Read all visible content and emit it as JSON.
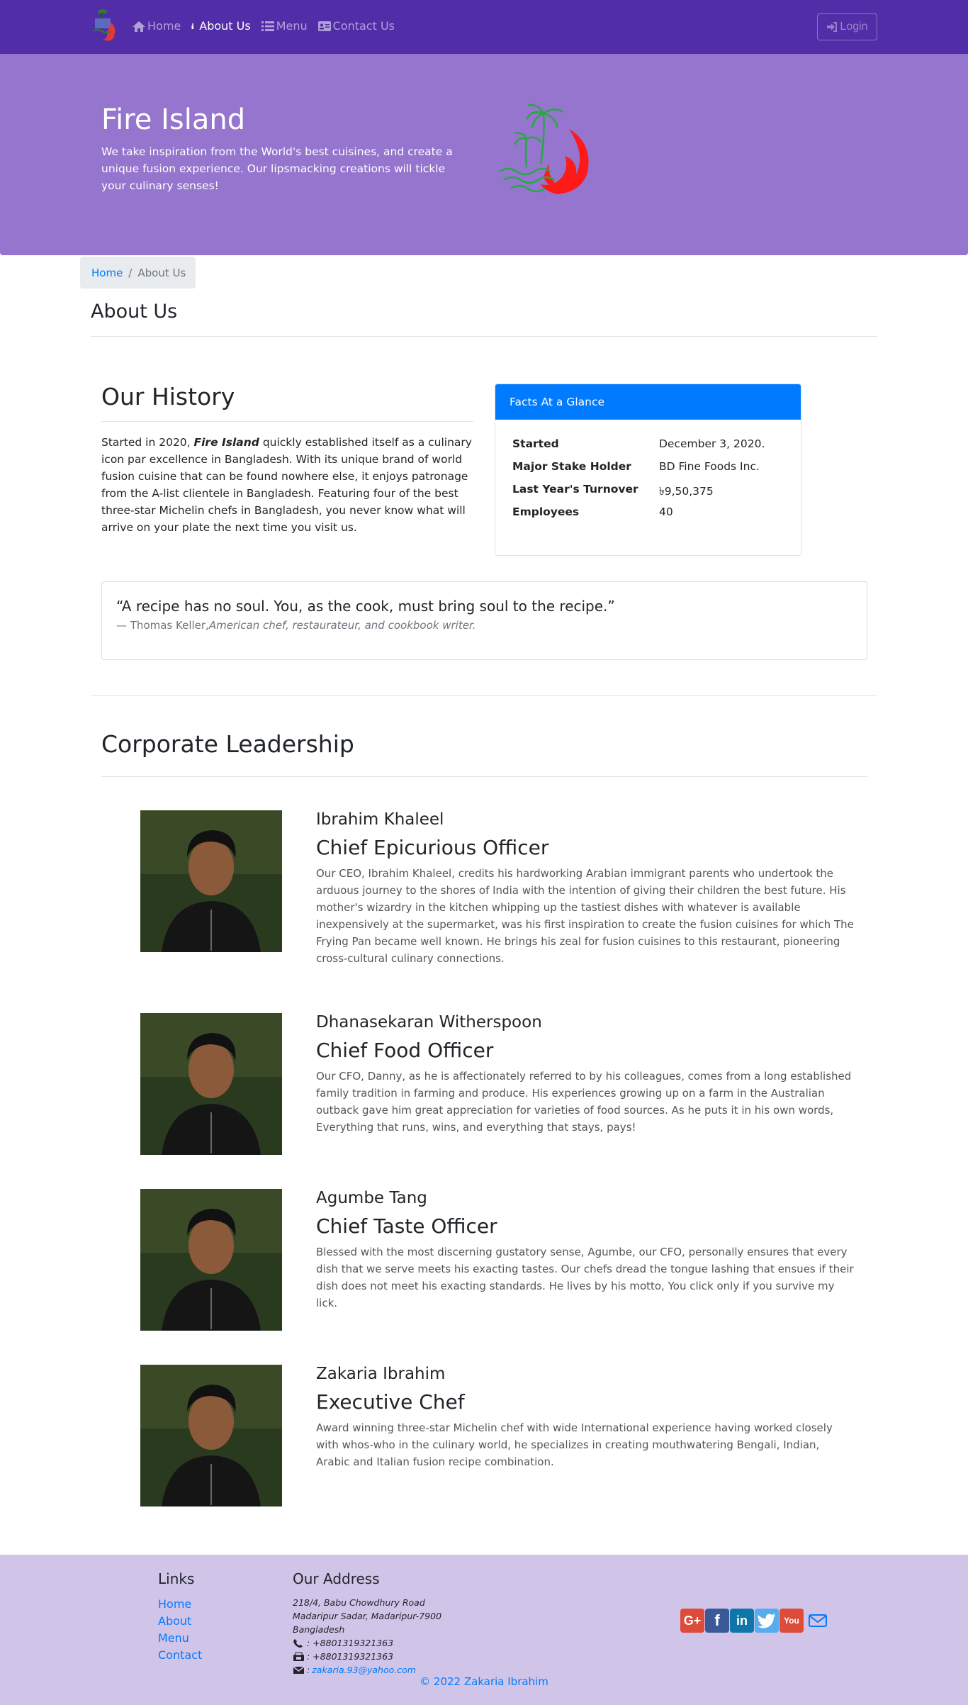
{
  "navbar": {
    "brand_icon": "fire-island-logo",
    "links": [
      {
        "label": "Home",
        "icon": "home-icon",
        "active": false
      },
      {
        "label": "About Us",
        "icon": "info-icon",
        "active": true
      },
      {
        "label": "Menu",
        "icon": "list-icon",
        "active": false
      },
      {
        "label": "Contact Us",
        "icon": "address-card-icon",
        "active": false
      }
    ],
    "login_label": "Login",
    "bg_color": "#512da8"
  },
  "jumbotron": {
    "title": "Fire Island",
    "text": "We take inspiration from the World's best cuisines, and create a unique fusion experience. Our lipsmacking creations will tickle your culinary senses!",
    "bg_color": "#9575cd"
  },
  "breadcrumb": {
    "home": "Home",
    "current": "About Us"
  },
  "page_title": "About Us",
  "history": {
    "title": "Our History",
    "text_before": "Started in 2020, ",
    "brand": "Fire Island",
    "text_after": " quickly established itself as a culinary icon par excellence in Bangladesh. With its unique brand of world fusion cuisine that can be found nowhere else, it enjoys patronage from the A-list clientele in Bangladesh. Featuring four of the best three-star Michelin chefs in Bangladesh, you never know what will arrive on your plate the next time you visit us."
  },
  "facts": {
    "header": "Facts At a Glance",
    "rows": [
      {
        "label": "Started",
        "value": "December 3, 2020."
      },
      {
        "label": "Major Stake Holder",
        "value": "BD Fine Foods Inc."
      },
      {
        "label": "Last Year's Turnover",
        "value": "৳9,50,375"
      },
      {
        "label": "Employees",
        "value": "40"
      }
    ]
  },
  "quote": {
    "text": "“A recipe has no soul. You, as the cook, must bring soul to the recipe.”",
    "author": "— Thomas Keller,",
    "source": "American chef, restaurateur, and cookbook writer."
  },
  "leadership": {
    "title": "Corporate Leadership",
    "leaders": [
      {
        "name": "Ibrahim Khaleel",
        "role": "Chief Epicurious Officer",
        "bio": "Our CEO, Ibrahim Khaleel, credits his hardworking Arabian immigrant parents who undertook the arduous journey to the shores of India with the intention of giving their children the best future. His mother's wizardry in the kitchen whipping up the tastiest dishes with whatever is available inexpensively at the supermarket, was his first inspiration to create the fusion cuisines for which The Frying Pan became well known. He brings his zeal for fusion cuisines to this restaurant, pioneering cross-cultural culinary connections."
      },
      {
        "name": "Dhanasekaran Witherspoon",
        "role": "Chief Food Officer",
        "bio": "Our CFO, Danny, as he is affectionately referred to by his colleagues, comes from a long established family tradition in farming and produce. His experiences growing up on a farm in the Australian outback gave him great appreciation for varieties of food sources. As he puts it in his own words, Everything that runs, wins, and everything that stays, pays!"
      },
      {
        "name": "Agumbe Tang",
        "role": "Chief Taste Officer",
        "bio": "Blessed with the most discerning gustatory sense, Agumbe, our CFO, personally ensures that every dish that we serve meets his exacting tastes. Our chefs dread the tongue lashing that ensues if their dish does not meet his exacting standards. He lives by his motto, You click only if you survive my lick."
      },
      {
        "name": "Zakaria Ibrahim",
        "role": "Executive Chef",
        "bio": "Award winning three-star Michelin chef with wide International experience having worked closely with whos-who in the culinary world, he specializes in creating mouthwatering Bengali, Indian, Arabic and Italian fusion recipe combination."
      }
    ]
  },
  "footer": {
    "links_title": "Links",
    "links": [
      "Home",
      "About",
      "Menu",
      "Contact"
    ],
    "address_title": "Our Address",
    "address_lines": [
      "218/4, Babu Chowdhury Road",
      "Madaripur Sadar, Madaripur-7900",
      "Bangladesh"
    ],
    "phone": ": +8801319321363",
    "fax": ": +8801319321363",
    "email_prefix": ": ",
    "email": "zakaria.93@yahoo.com",
    "socials": [
      {
        "icon": "google-plus-icon",
        "glyph": "G+"
      },
      {
        "icon": "facebook-icon",
        "glyph": "f"
      },
      {
        "icon": "linkedin-icon",
        "glyph": "in"
      },
      {
        "icon": "twitter-icon",
        "glyph": "🐦"
      },
      {
        "icon": "youtube-icon",
        "glyph": "You"
      },
      {
        "icon": "envelope-icon",
        "glyph": ""
      }
    ],
    "copyright": "© 2022 Zakaria Ibrahim",
    "bg_color": "#d1c4e9"
  }
}
